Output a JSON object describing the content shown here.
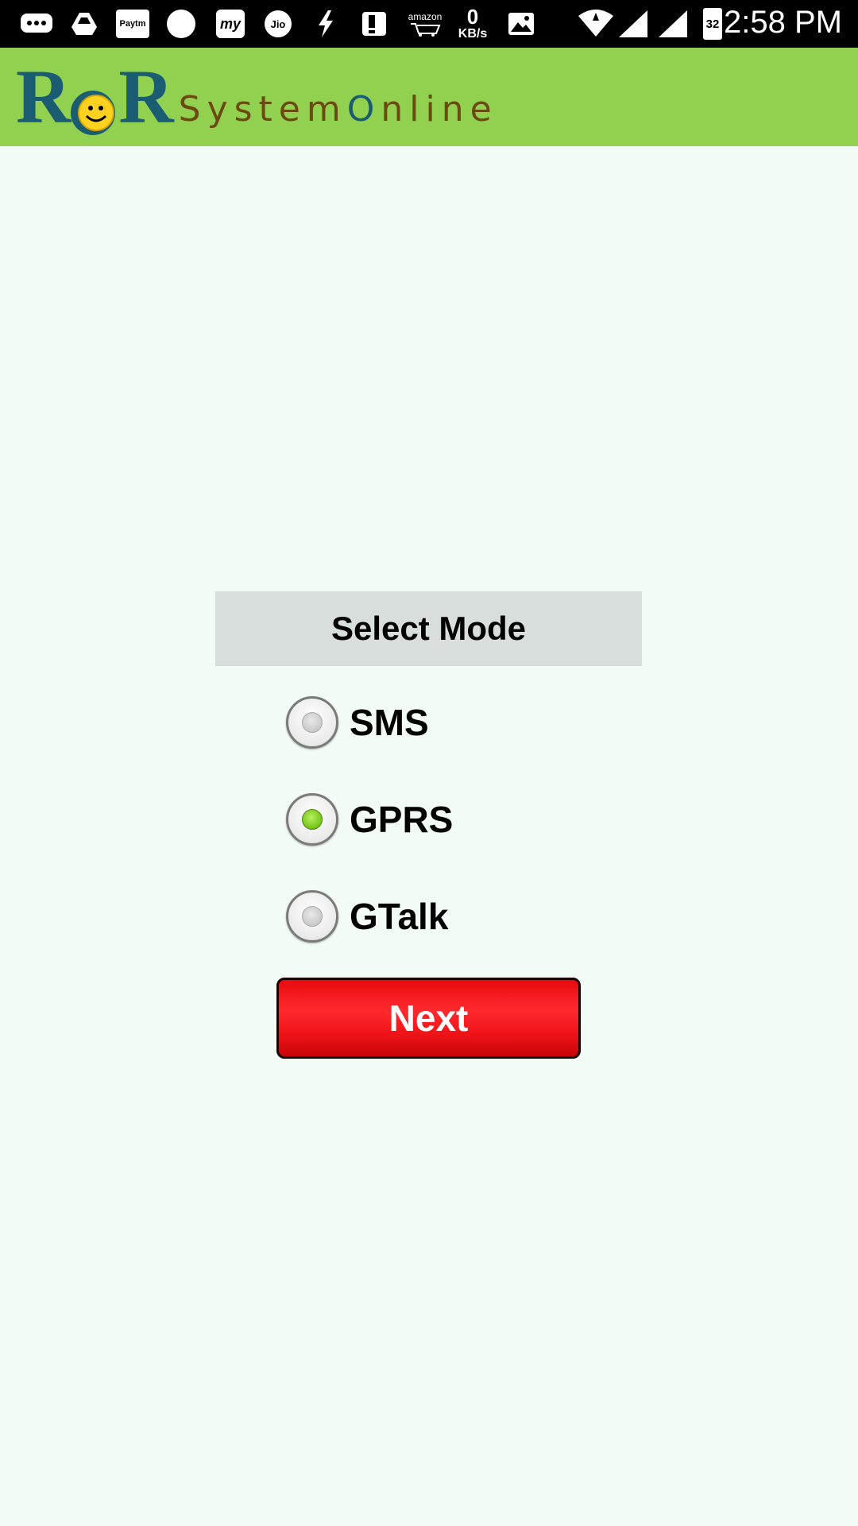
{
  "status_bar": {
    "time": "2:58 PM",
    "network_speed_value": "0",
    "network_speed_unit": "KB/s",
    "battery_level": "32",
    "paytm_label": "Paytm",
    "jio_label": "Jio",
    "myjio_label": "my",
    "amazon_label": "amazon"
  },
  "app_bar": {
    "logo_letters_left": "R",
    "logo_letters_right": "R",
    "logo_tagline_part1": "System",
    "logo_tagline_part2": "O",
    "logo_tagline_part3": "nline"
  },
  "mode_select": {
    "title": "Select Mode",
    "options": [
      {
        "label": "SMS",
        "checked": false
      },
      {
        "label": "GPRS",
        "checked": true
      },
      {
        "label": "GTalk",
        "checked": false
      }
    ]
  },
  "actions": {
    "next_label": "Next"
  },
  "colors": {
    "app_bar_bg": "#92d050",
    "page_bg": "#f3fbf7",
    "header_bg": "#d8dedc",
    "next_button": "#ff2a2e",
    "radio_checked": "#72c416"
  }
}
